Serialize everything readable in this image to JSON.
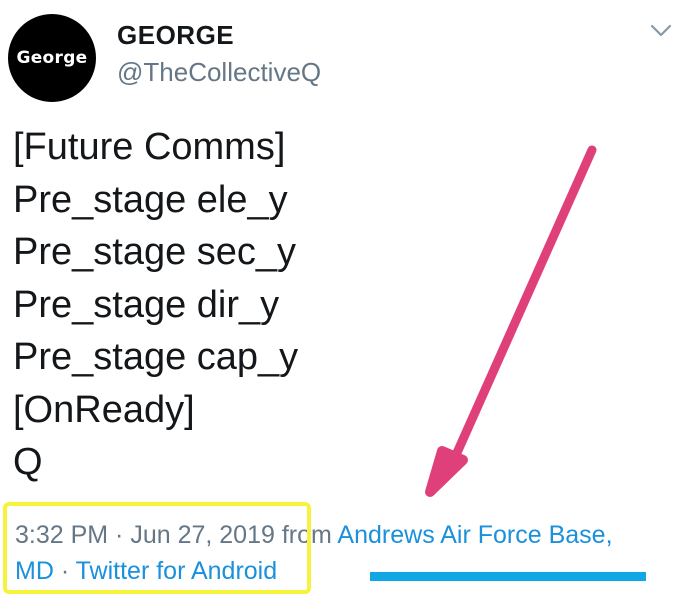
{
  "profile": {
    "avatar_text": "George",
    "display_name": "GEORGE",
    "handle": "@TheCollectiveQ"
  },
  "tweet": {
    "lines": [
      "[Future Comms]",
      "Pre_stage ele_y",
      "Pre_stage sec_y",
      "Pre_stage dir_y",
      "Pre_stage cap_y",
      "[OnReady]",
      "Q"
    ]
  },
  "meta": {
    "time": "3:32 PM",
    "separator": " · ",
    "date": "Jun 27, 2019",
    "from": " from ",
    "location_line1": "Andrews Air Force Base,",
    "location_line2": "MD",
    "source": "Twitter for Android"
  },
  "icons": {
    "menu": "chevron-down-icon"
  },
  "colors": {
    "text": "#14171a",
    "secondary": "#657786",
    "link": "#1a91da",
    "annotation_arrow": "#e0407a",
    "annotation_box": "#f7f23a",
    "annotation_underline": "#10a7e4"
  }
}
